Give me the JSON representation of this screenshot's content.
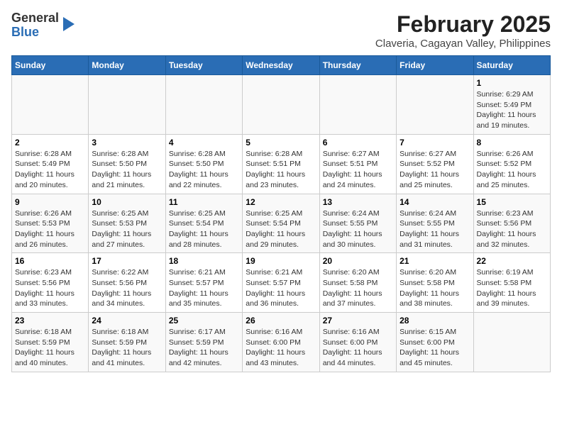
{
  "logo": {
    "general": "General",
    "blue": "Blue"
  },
  "title": "February 2025",
  "subtitle": "Claveria, Cagayan Valley, Philippines",
  "days_of_week": [
    "Sunday",
    "Monday",
    "Tuesday",
    "Wednesday",
    "Thursday",
    "Friday",
    "Saturday"
  ],
  "weeks": [
    [
      {
        "day": "",
        "sunrise": "",
        "sunset": "",
        "daylight": ""
      },
      {
        "day": "",
        "sunrise": "",
        "sunset": "",
        "daylight": ""
      },
      {
        "day": "",
        "sunrise": "",
        "sunset": "",
        "daylight": ""
      },
      {
        "day": "",
        "sunrise": "",
        "sunset": "",
        "daylight": ""
      },
      {
        "day": "",
        "sunrise": "",
        "sunset": "",
        "daylight": ""
      },
      {
        "day": "",
        "sunrise": "",
        "sunset": "",
        "daylight": ""
      },
      {
        "day": "1",
        "sunrise": "6:29 AM",
        "sunset": "5:49 PM",
        "daylight": "11 hours and 19 minutes."
      }
    ],
    [
      {
        "day": "2",
        "sunrise": "6:28 AM",
        "sunset": "5:49 PM",
        "daylight": "11 hours and 20 minutes."
      },
      {
        "day": "3",
        "sunrise": "6:28 AM",
        "sunset": "5:50 PM",
        "daylight": "11 hours and 21 minutes."
      },
      {
        "day": "4",
        "sunrise": "6:28 AM",
        "sunset": "5:50 PM",
        "daylight": "11 hours and 22 minutes."
      },
      {
        "day": "5",
        "sunrise": "6:28 AM",
        "sunset": "5:51 PM",
        "daylight": "11 hours and 23 minutes."
      },
      {
        "day": "6",
        "sunrise": "6:27 AM",
        "sunset": "5:51 PM",
        "daylight": "11 hours and 24 minutes."
      },
      {
        "day": "7",
        "sunrise": "6:27 AM",
        "sunset": "5:52 PM",
        "daylight": "11 hours and 25 minutes."
      },
      {
        "day": "8",
        "sunrise": "6:26 AM",
        "sunset": "5:52 PM",
        "daylight": "11 hours and 25 minutes."
      }
    ],
    [
      {
        "day": "9",
        "sunrise": "6:26 AM",
        "sunset": "5:53 PM",
        "daylight": "11 hours and 26 minutes."
      },
      {
        "day": "10",
        "sunrise": "6:25 AM",
        "sunset": "5:53 PM",
        "daylight": "11 hours and 27 minutes."
      },
      {
        "day": "11",
        "sunrise": "6:25 AM",
        "sunset": "5:54 PM",
        "daylight": "11 hours and 28 minutes."
      },
      {
        "day": "12",
        "sunrise": "6:25 AM",
        "sunset": "5:54 PM",
        "daylight": "11 hours and 29 minutes."
      },
      {
        "day": "13",
        "sunrise": "6:24 AM",
        "sunset": "5:55 PM",
        "daylight": "11 hours and 30 minutes."
      },
      {
        "day": "14",
        "sunrise": "6:24 AM",
        "sunset": "5:55 PM",
        "daylight": "11 hours and 31 minutes."
      },
      {
        "day": "15",
        "sunrise": "6:23 AM",
        "sunset": "5:56 PM",
        "daylight": "11 hours and 32 minutes."
      }
    ],
    [
      {
        "day": "16",
        "sunrise": "6:23 AM",
        "sunset": "5:56 PM",
        "daylight": "11 hours and 33 minutes."
      },
      {
        "day": "17",
        "sunrise": "6:22 AM",
        "sunset": "5:56 PM",
        "daylight": "11 hours and 34 minutes."
      },
      {
        "day": "18",
        "sunrise": "6:21 AM",
        "sunset": "5:57 PM",
        "daylight": "11 hours and 35 minutes."
      },
      {
        "day": "19",
        "sunrise": "6:21 AM",
        "sunset": "5:57 PM",
        "daylight": "11 hours and 36 minutes."
      },
      {
        "day": "20",
        "sunrise": "6:20 AM",
        "sunset": "5:58 PM",
        "daylight": "11 hours and 37 minutes."
      },
      {
        "day": "21",
        "sunrise": "6:20 AM",
        "sunset": "5:58 PM",
        "daylight": "11 hours and 38 minutes."
      },
      {
        "day": "22",
        "sunrise": "6:19 AM",
        "sunset": "5:58 PM",
        "daylight": "11 hours and 39 minutes."
      }
    ],
    [
      {
        "day": "23",
        "sunrise": "6:18 AM",
        "sunset": "5:59 PM",
        "daylight": "11 hours and 40 minutes."
      },
      {
        "day": "24",
        "sunrise": "6:18 AM",
        "sunset": "5:59 PM",
        "daylight": "11 hours and 41 minutes."
      },
      {
        "day": "25",
        "sunrise": "6:17 AM",
        "sunset": "5:59 PM",
        "daylight": "11 hours and 42 minutes."
      },
      {
        "day": "26",
        "sunrise": "6:16 AM",
        "sunset": "6:00 PM",
        "daylight": "11 hours and 43 minutes."
      },
      {
        "day": "27",
        "sunrise": "6:16 AM",
        "sunset": "6:00 PM",
        "daylight": "11 hours and 44 minutes."
      },
      {
        "day": "28",
        "sunrise": "6:15 AM",
        "sunset": "6:00 PM",
        "daylight": "11 hours and 45 minutes."
      },
      {
        "day": "",
        "sunrise": "",
        "sunset": "",
        "daylight": ""
      }
    ]
  ]
}
